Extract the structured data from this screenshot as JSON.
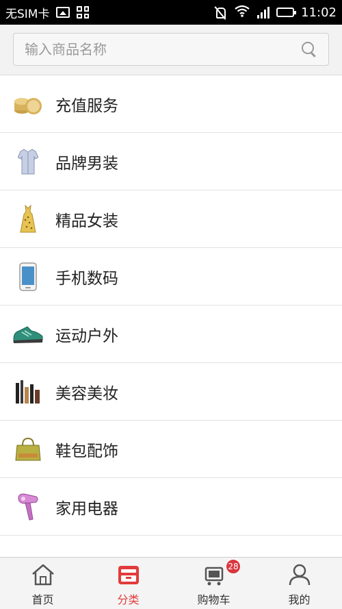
{
  "status_bar": {
    "carrier": "无SIM卡",
    "time": "11:02"
  },
  "search": {
    "placeholder": "输入商品名称"
  },
  "categories": [
    {
      "label": "充值服务",
      "icon": "coins-icon"
    },
    {
      "label": "品牌男装",
      "icon": "shirt-icon"
    },
    {
      "label": "精品女装",
      "icon": "dress-icon"
    },
    {
      "label": "手机数码",
      "icon": "phone-icon"
    },
    {
      "label": "运动户外",
      "icon": "sneaker-icon"
    },
    {
      "label": "美容美妆",
      "icon": "cosmetics-icon"
    },
    {
      "label": "鞋包配饰",
      "icon": "handbag-icon"
    },
    {
      "label": "家用电器",
      "icon": "hairdryer-icon"
    }
  ],
  "tabs": [
    {
      "label": "首页",
      "icon": "home-icon",
      "active": false
    },
    {
      "label": "分类",
      "icon": "category-icon",
      "active": true
    },
    {
      "label": "购物车",
      "icon": "cart-icon",
      "active": false,
      "badge": "28"
    },
    {
      "label": "我的",
      "icon": "user-icon",
      "active": false
    }
  ],
  "colors": {
    "accent": "#e23b3b",
    "badge": "#d9363e",
    "background": "#ffffff"
  }
}
